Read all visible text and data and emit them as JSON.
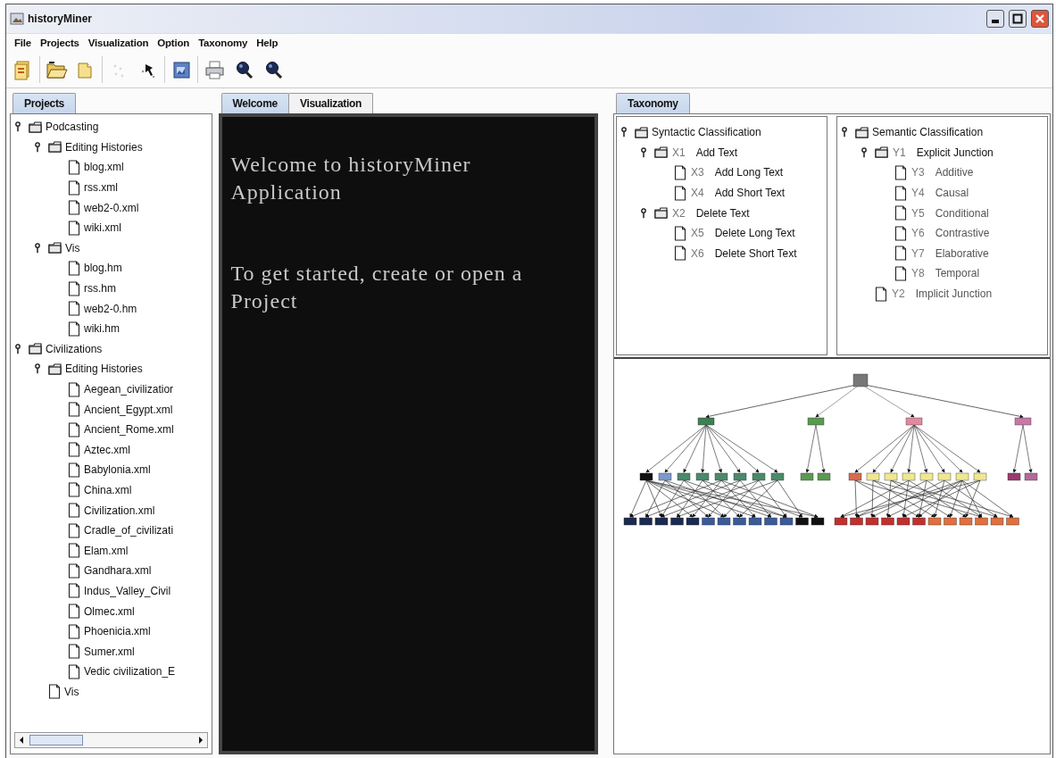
{
  "window": {
    "title": "historyMiner"
  },
  "menu": [
    "File",
    "Projects",
    "Visualization",
    "Option",
    "Taxonomy",
    "Help"
  ],
  "toolbar": [
    {
      "kind": "new",
      "disabled": false
    },
    {
      "kind": "open",
      "disabled": false
    },
    {
      "kind": "folder",
      "disabled": false
    },
    {
      "kind": "scatter",
      "disabled": true
    },
    {
      "kind": "pointer",
      "disabled": false
    },
    {
      "kind": "picture",
      "disabled": false
    },
    {
      "kind": "print",
      "disabled": false
    },
    {
      "kind": "zoom",
      "disabled": false
    },
    {
      "kind": "zoom",
      "disabled": false
    }
  ],
  "projects_panel": {
    "tabs": [
      {
        "label": "Projects",
        "selected": true
      }
    ],
    "tree": [
      {
        "label": "Podcasting",
        "kind": "folder",
        "expanded": true,
        "children": [
          {
            "label": "Editing Histories",
            "kind": "folder",
            "expanded": true,
            "children": [
              {
                "label": "blog.xml",
                "kind": "file"
              },
              {
                "label": "rss.xml",
                "kind": "file"
              },
              {
                "label": "web2-0.xml",
                "kind": "file"
              },
              {
                "label": "wiki.xml",
                "kind": "file"
              }
            ]
          },
          {
            "label": "Vis",
            "kind": "folder",
            "expanded": true,
            "children": [
              {
                "label": "blog.hm",
                "kind": "file"
              },
              {
                "label": "rss.hm",
                "kind": "file"
              },
              {
                "label": "web2-0.hm",
                "kind": "file"
              },
              {
                "label": "wiki.hm",
                "kind": "file"
              }
            ]
          }
        ]
      },
      {
        "label": "Civilizations",
        "kind": "folder",
        "expanded": true,
        "children": [
          {
            "label": "Editing Histories",
            "kind": "folder",
            "expanded": true,
            "children": [
              {
                "label": "Aegean_civilizatior",
                "kind": "file"
              },
              {
                "label": "Ancient_Egypt.xml",
                "kind": "file"
              },
              {
                "label": "Ancient_Rome.xml",
                "kind": "file"
              },
              {
                "label": "Aztec.xml",
                "kind": "file"
              },
              {
                "label": "Babylonia.xml",
                "kind": "file"
              },
              {
                "label": "China.xml",
                "kind": "file"
              },
              {
                "label": "Civilization.xml",
                "kind": "file"
              },
              {
                "label": "Cradle_of_civilizati",
                "kind": "file"
              },
              {
                "label": "Elam.xml",
                "kind": "file"
              },
              {
                "label": "Gandhara.xml",
                "kind": "file"
              },
              {
                "label": "Indus_Valley_Civil",
                "kind": "file"
              },
              {
                "label": "Olmec.xml",
                "kind": "file"
              },
              {
                "label": "Phoenicia.xml",
                "kind": "file"
              },
              {
                "label": "Sumer.xml",
                "kind": "file"
              },
              {
                "label": "Vedic civilization_E",
                "kind": "file"
              }
            ]
          },
          {
            "label": "Vis",
            "kind": "file"
          }
        ]
      }
    ]
  },
  "center_panel": {
    "tabs": [
      {
        "label": "Welcome",
        "selected": true
      },
      {
        "label": "Visualization",
        "selected": false
      }
    ],
    "welcome_heading": "Welcome to historyMiner Application",
    "welcome_hint": "To get started, create or open a Project"
  },
  "taxonomy_panel": {
    "tabs": [
      {
        "label": "Taxonomy",
        "selected": true
      }
    ],
    "syntactic_tree": [
      {
        "label": "Syntactic Classification",
        "kind": "folder",
        "expanded": true,
        "children": [
          {
            "code": "X1",
            "label": "Add Text",
            "kind": "folder",
            "expanded": true,
            "children": [
              {
                "code": "X3",
                "label": "Add Long Text",
                "kind": "file"
              },
              {
                "code": "X4",
                "label": "Add Short Text",
                "kind": "file"
              }
            ]
          },
          {
            "code": "X2",
            "label": "Delete Text",
            "kind": "folder",
            "expanded": true,
            "children": [
              {
                "code": "X5",
                "label": "Delete Long Text",
                "kind": "file"
              },
              {
                "code": "X6",
                "label": "Delete Short Text",
                "kind": "file"
              }
            ]
          }
        ]
      }
    ],
    "semantic_tree": [
      {
        "label": "Semantic Classification",
        "kind": "folder",
        "expanded": true,
        "children": [
          {
            "code": "Y1",
            "label": "Explicit Junction",
            "kind": "folder",
            "expanded": true,
            "children": [
              {
                "code": "Y3",
                "label": "Additive",
                "kind": "file"
              },
              {
                "code": "Y4",
                "label": "Causal",
                "kind": "file"
              },
              {
                "code": "Y5",
                "label": "Conditional",
                "kind": "file"
              },
              {
                "code": "Y6",
                "label": "Contrastive",
                "kind": "file"
              },
              {
                "code": "Y7",
                "label": "Elaborative",
                "kind": "file"
              },
              {
                "code": "Y8",
                "label": "Temporal",
                "kind": "file"
              }
            ]
          },
          {
            "code": "Y2",
            "label": "Implicit Junction",
            "kind": "file"
          }
        ]
      }
    ]
  }
}
